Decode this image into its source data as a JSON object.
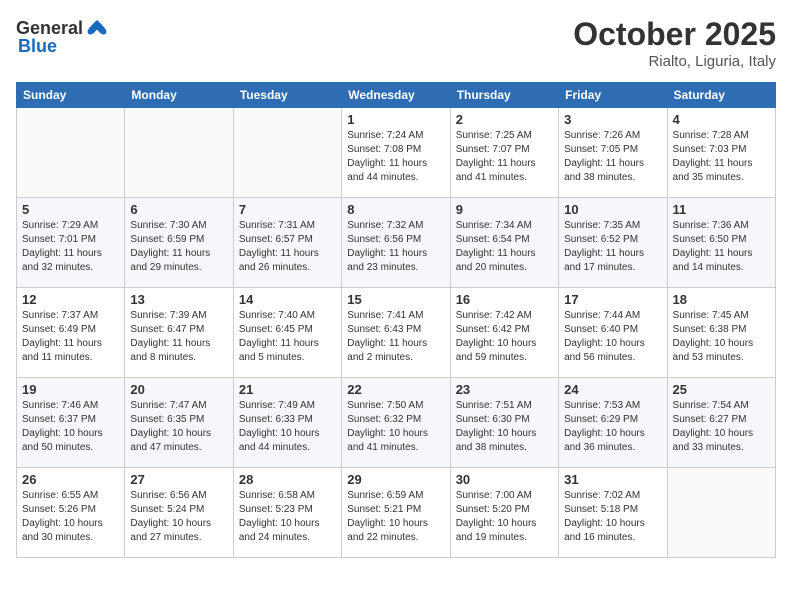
{
  "header": {
    "logo_general": "General",
    "logo_blue": "Blue",
    "month": "October 2025",
    "location": "Rialto, Liguria, Italy"
  },
  "weekdays": [
    "Sunday",
    "Monday",
    "Tuesday",
    "Wednesday",
    "Thursday",
    "Friday",
    "Saturday"
  ],
  "weeks": [
    [
      {
        "day": "",
        "info": ""
      },
      {
        "day": "",
        "info": ""
      },
      {
        "day": "",
        "info": ""
      },
      {
        "day": "1",
        "info": "Sunrise: 7:24 AM\nSunset: 7:08 PM\nDaylight: 11 hours and 44 minutes."
      },
      {
        "day": "2",
        "info": "Sunrise: 7:25 AM\nSunset: 7:07 PM\nDaylight: 11 hours and 41 minutes."
      },
      {
        "day": "3",
        "info": "Sunrise: 7:26 AM\nSunset: 7:05 PM\nDaylight: 11 hours and 38 minutes."
      },
      {
        "day": "4",
        "info": "Sunrise: 7:28 AM\nSunset: 7:03 PM\nDaylight: 11 hours and 35 minutes."
      }
    ],
    [
      {
        "day": "5",
        "info": "Sunrise: 7:29 AM\nSunset: 7:01 PM\nDaylight: 11 hours and 32 minutes."
      },
      {
        "day": "6",
        "info": "Sunrise: 7:30 AM\nSunset: 6:59 PM\nDaylight: 11 hours and 29 minutes."
      },
      {
        "day": "7",
        "info": "Sunrise: 7:31 AM\nSunset: 6:57 PM\nDaylight: 11 hours and 26 minutes."
      },
      {
        "day": "8",
        "info": "Sunrise: 7:32 AM\nSunset: 6:56 PM\nDaylight: 11 hours and 23 minutes."
      },
      {
        "day": "9",
        "info": "Sunrise: 7:34 AM\nSunset: 6:54 PM\nDaylight: 11 hours and 20 minutes."
      },
      {
        "day": "10",
        "info": "Sunrise: 7:35 AM\nSunset: 6:52 PM\nDaylight: 11 hours and 17 minutes."
      },
      {
        "day": "11",
        "info": "Sunrise: 7:36 AM\nSunset: 6:50 PM\nDaylight: 11 hours and 14 minutes."
      }
    ],
    [
      {
        "day": "12",
        "info": "Sunrise: 7:37 AM\nSunset: 6:49 PM\nDaylight: 11 hours and 11 minutes."
      },
      {
        "day": "13",
        "info": "Sunrise: 7:39 AM\nSunset: 6:47 PM\nDaylight: 11 hours and 8 minutes."
      },
      {
        "day": "14",
        "info": "Sunrise: 7:40 AM\nSunset: 6:45 PM\nDaylight: 11 hours and 5 minutes."
      },
      {
        "day": "15",
        "info": "Sunrise: 7:41 AM\nSunset: 6:43 PM\nDaylight: 11 hours and 2 minutes."
      },
      {
        "day": "16",
        "info": "Sunrise: 7:42 AM\nSunset: 6:42 PM\nDaylight: 10 hours and 59 minutes."
      },
      {
        "day": "17",
        "info": "Sunrise: 7:44 AM\nSunset: 6:40 PM\nDaylight: 10 hours and 56 minutes."
      },
      {
        "day": "18",
        "info": "Sunrise: 7:45 AM\nSunset: 6:38 PM\nDaylight: 10 hours and 53 minutes."
      }
    ],
    [
      {
        "day": "19",
        "info": "Sunrise: 7:46 AM\nSunset: 6:37 PM\nDaylight: 10 hours and 50 minutes."
      },
      {
        "day": "20",
        "info": "Sunrise: 7:47 AM\nSunset: 6:35 PM\nDaylight: 10 hours and 47 minutes."
      },
      {
        "day": "21",
        "info": "Sunrise: 7:49 AM\nSunset: 6:33 PM\nDaylight: 10 hours and 44 minutes."
      },
      {
        "day": "22",
        "info": "Sunrise: 7:50 AM\nSunset: 6:32 PM\nDaylight: 10 hours and 41 minutes."
      },
      {
        "day": "23",
        "info": "Sunrise: 7:51 AM\nSunset: 6:30 PM\nDaylight: 10 hours and 38 minutes."
      },
      {
        "day": "24",
        "info": "Sunrise: 7:53 AM\nSunset: 6:29 PM\nDaylight: 10 hours and 36 minutes."
      },
      {
        "day": "25",
        "info": "Sunrise: 7:54 AM\nSunset: 6:27 PM\nDaylight: 10 hours and 33 minutes."
      }
    ],
    [
      {
        "day": "26",
        "info": "Sunrise: 6:55 AM\nSunset: 5:26 PM\nDaylight: 10 hours and 30 minutes."
      },
      {
        "day": "27",
        "info": "Sunrise: 6:56 AM\nSunset: 5:24 PM\nDaylight: 10 hours and 27 minutes."
      },
      {
        "day": "28",
        "info": "Sunrise: 6:58 AM\nSunset: 5:23 PM\nDaylight: 10 hours and 24 minutes."
      },
      {
        "day": "29",
        "info": "Sunrise: 6:59 AM\nSunset: 5:21 PM\nDaylight: 10 hours and 22 minutes."
      },
      {
        "day": "30",
        "info": "Sunrise: 7:00 AM\nSunset: 5:20 PM\nDaylight: 10 hours and 19 minutes."
      },
      {
        "day": "31",
        "info": "Sunrise: 7:02 AM\nSunset: 5:18 PM\nDaylight: 10 hours and 16 minutes."
      },
      {
        "day": "",
        "info": ""
      }
    ]
  ]
}
